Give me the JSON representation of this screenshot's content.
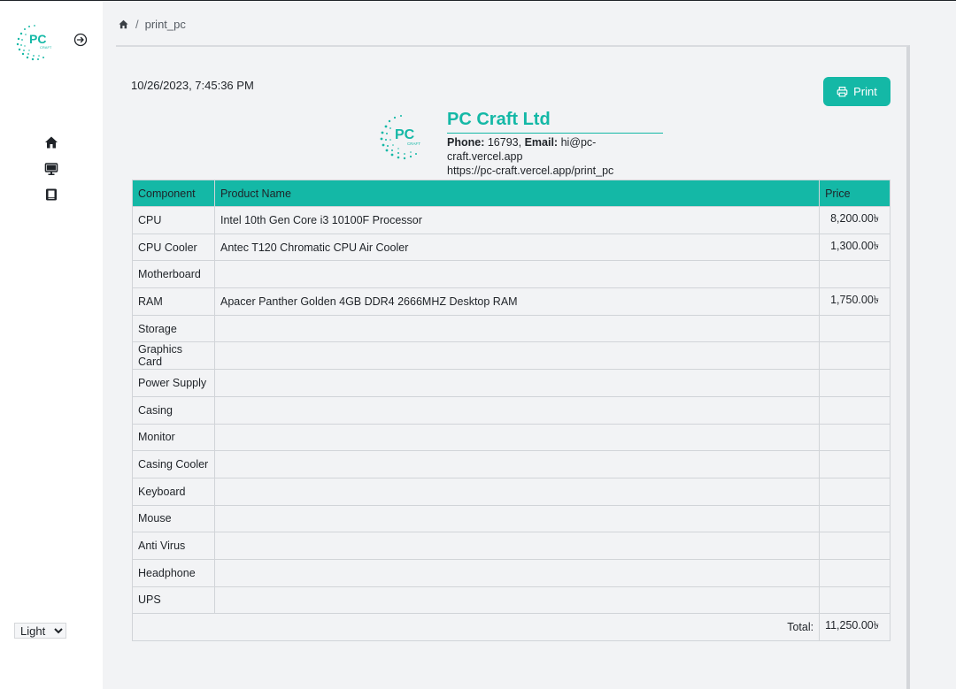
{
  "sidebar": {
    "logo_text": "PC",
    "logo_subtext": "CRAFT",
    "nav": [
      {
        "name": "home-icon"
      },
      {
        "name": "monitor-icon"
      },
      {
        "name": "book-icon"
      }
    ],
    "theme": {
      "selected": "Light",
      "options": [
        "Light"
      ]
    }
  },
  "breadcrumb": {
    "separator": "/",
    "current": "print_pc"
  },
  "page": {
    "timestamp": "10/26/2023, 7:45:36 PM",
    "print_label": "Print"
  },
  "company": {
    "name": "PC Craft Ltd",
    "phone_label": "Phone:",
    "phone": "16793,",
    "email_label": "Email:",
    "email": "hi@pc-craft.vercel.app",
    "url": "https://pc-craft.vercel.app/print_pc",
    "logo_text": "PC",
    "logo_subtext": "CRAFT"
  },
  "table": {
    "headers": [
      "Component",
      "Product Name",
      "Price"
    ],
    "rows": [
      {
        "component": "CPU",
        "product": "Intel 10th Gen Core i3 10100F Processor",
        "price": "8,200.00৳"
      },
      {
        "component": "CPU Cooler",
        "product": "Antec T120 Chromatic CPU Air Cooler",
        "price": "1,300.00৳"
      },
      {
        "component": "Motherboard",
        "product": "",
        "price": ""
      },
      {
        "component": "RAM",
        "product": "Apacer Panther Golden 4GB DDR4 2666MHZ Desktop RAM",
        "price": "1,750.00৳"
      },
      {
        "component": "Storage",
        "product": "",
        "price": ""
      },
      {
        "component": "Graphics Card",
        "product": "",
        "price": ""
      },
      {
        "component": "Power Supply",
        "product": "",
        "price": ""
      },
      {
        "component": "Casing",
        "product": "",
        "price": ""
      },
      {
        "component": "Monitor",
        "product": "",
        "price": ""
      },
      {
        "component": "Casing Cooler",
        "product": "",
        "price": ""
      },
      {
        "component": "Keyboard",
        "product": "",
        "price": ""
      },
      {
        "component": "Mouse",
        "product": "",
        "price": ""
      },
      {
        "component": "Anti Virus",
        "product": "",
        "price": ""
      },
      {
        "component": "Headphone",
        "product": "",
        "price": ""
      },
      {
        "component": "UPS",
        "product": "",
        "price": ""
      }
    ],
    "total_label": "Total:",
    "total_value": "11,250.00৳"
  },
  "colors": {
    "accent": "#14b8a6",
    "sidebar_bg": "#ffffff",
    "page_bg": "#f2f3f5"
  }
}
